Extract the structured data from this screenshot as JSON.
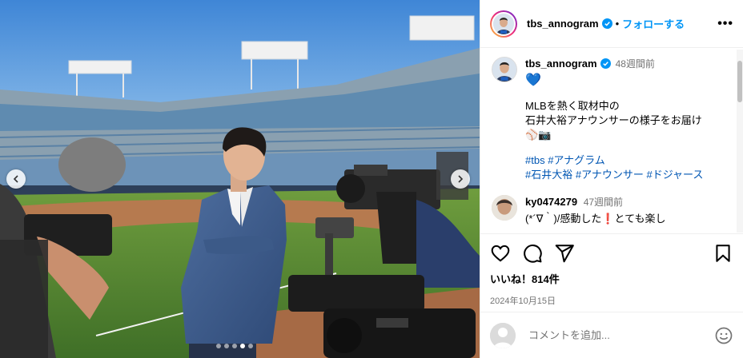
{
  "colors": {
    "accent": "#0095f6",
    "verified": "#0095f6",
    "hashtag": "#00376b",
    "muted": "#737373"
  },
  "header": {
    "username": "tbs_annogram",
    "separator": "•",
    "follow_label": "フォローする",
    "more_icon": "more-horizontal-icon",
    "more_label": "•••"
  },
  "caption": {
    "username": "tbs_annogram",
    "time": "48週間前",
    "heart": "💙",
    "text": "MLBを熱く取材中の\n石井大裕アナウンサーの様子をお届け\n⚾📷",
    "hashtags": [
      "#tbs",
      "#アナグラム",
      "#石井大裕",
      "#アナウンサー",
      "#ドジャース"
    ]
  },
  "comment": {
    "username": "ky0474279",
    "time": "47週間前",
    "text": "(*´∇｀)/感動した❗とても楽し"
  },
  "actions": {
    "icons": [
      "heart-icon",
      "comment-icon",
      "share-icon",
      "bookmark-icon"
    ],
    "likes_text": "いいね！814件",
    "date": "2024年10月15日"
  },
  "add_comment": {
    "placeholder": "コメントを追加..."
  },
  "media": {
    "slide_count": 5,
    "active_slide": 3
  }
}
